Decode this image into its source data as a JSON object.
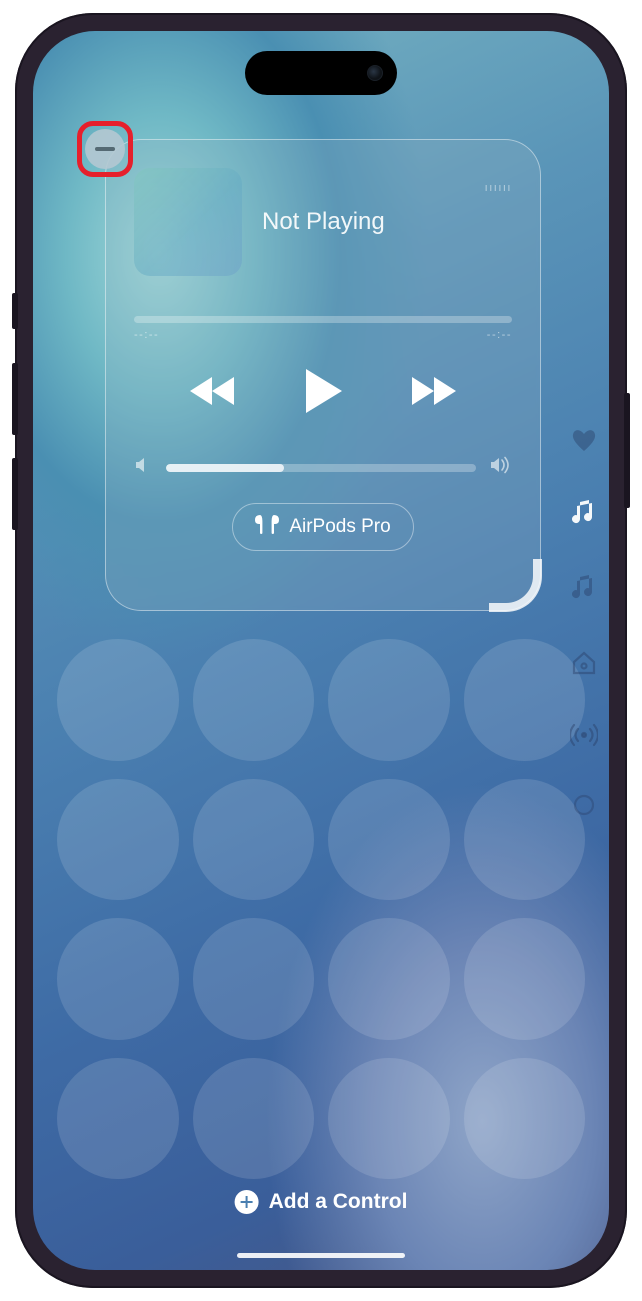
{
  "music": {
    "title": "Not Playing",
    "soundWave": "ıııııı",
    "elapsed": "--:--",
    "remaining": "--:--",
    "output": "AirPods Pro"
  },
  "addControl": "Add a Control",
  "sideNav": {
    "heart": "favorites",
    "musicActive": "now-playing",
    "musicAlt": "music-alt",
    "home": "home",
    "connectivity": "connectivity",
    "custom": "custom"
  }
}
